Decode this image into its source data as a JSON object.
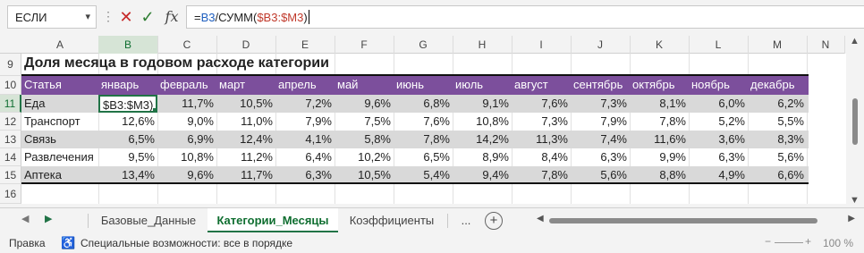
{
  "formula_bar": {
    "name_box": "ЕСЛИ",
    "dots": "⋮",
    "cancel": "✕",
    "enter": "✓",
    "fx": "fx",
    "formula_prefix": "=",
    "formula_ref1": "B3",
    "formula_mid": "/СУММ(",
    "formula_ref2": "$B3:$M3",
    "formula_suffix": ")"
  },
  "columns": [
    "A",
    "B",
    "C",
    "D",
    "E",
    "F",
    "G",
    "H",
    "I",
    "J",
    "K",
    "L",
    "M",
    "N"
  ],
  "sheet": {
    "title_row": "9",
    "title": "Доля месяца в годовом расходе категории",
    "header_row": "10",
    "header": [
      "Статья",
      "январь",
      "февраль",
      "март",
      "апрель",
      "май",
      "июнь",
      "июль",
      "август",
      "сентябрь",
      "октябрь",
      "ноябрь",
      "декабрь"
    ],
    "rows": [
      {
        "num": "11",
        "cells": [
          "Еда",
          "$B3:$M3)",
          "11,7%",
          "10,5%",
          "7,2%",
          "9,6%",
          "6,8%",
          "9,1%",
          "7,6%",
          "7,3%",
          "8,1%",
          "6,0%",
          "6,2%"
        ]
      },
      {
        "num": "12",
        "cells": [
          "Транспорт",
          "12,6%",
          "9,0%",
          "11,0%",
          "7,9%",
          "7,5%",
          "7,6%",
          "10,8%",
          "7,3%",
          "7,9%",
          "7,8%",
          "5,2%",
          "5,5%"
        ]
      },
      {
        "num": "13",
        "cells": [
          "Связь",
          "6,5%",
          "6,9%",
          "12,4%",
          "4,1%",
          "5,8%",
          "7,8%",
          "14,2%",
          "11,3%",
          "7,4%",
          "11,6%",
          "3,6%",
          "8,3%"
        ]
      },
      {
        "num": "14",
        "cells": [
          "Развлечения",
          "9,5%",
          "10,8%",
          "11,2%",
          "6,4%",
          "10,2%",
          "6,5%",
          "8,9%",
          "8,4%",
          "6,3%",
          "9,9%",
          "6,3%",
          "5,6%"
        ]
      },
      {
        "num": "15",
        "cells": [
          "Аптека",
          "13,4%",
          "9,6%",
          "11,7%",
          "6,3%",
          "10,5%",
          "5,4%",
          "9,4%",
          "7,8%",
          "5,6%",
          "8,8%",
          "4,9%",
          "6,6%"
        ]
      }
    ],
    "empty_row": "16"
  },
  "tabs": {
    "items": [
      "Базовые_Данные",
      "Категории_Месяцы",
      "Коэффициенты"
    ],
    "selected": 1,
    "more": "...",
    "add": "+"
  },
  "status": {
    "mode": "Правка",
    "accessibility": "Специальные возможности: все в порядке",
    "zoom_out": "−",
    "zoom_in": "+",
    "zoom": "100 %"
  },
  "colors": {
    "header_fill": "#7c4f9c",
    "band_fill": "#d9d9d9",
    "selection": "#217346"
  }
}
